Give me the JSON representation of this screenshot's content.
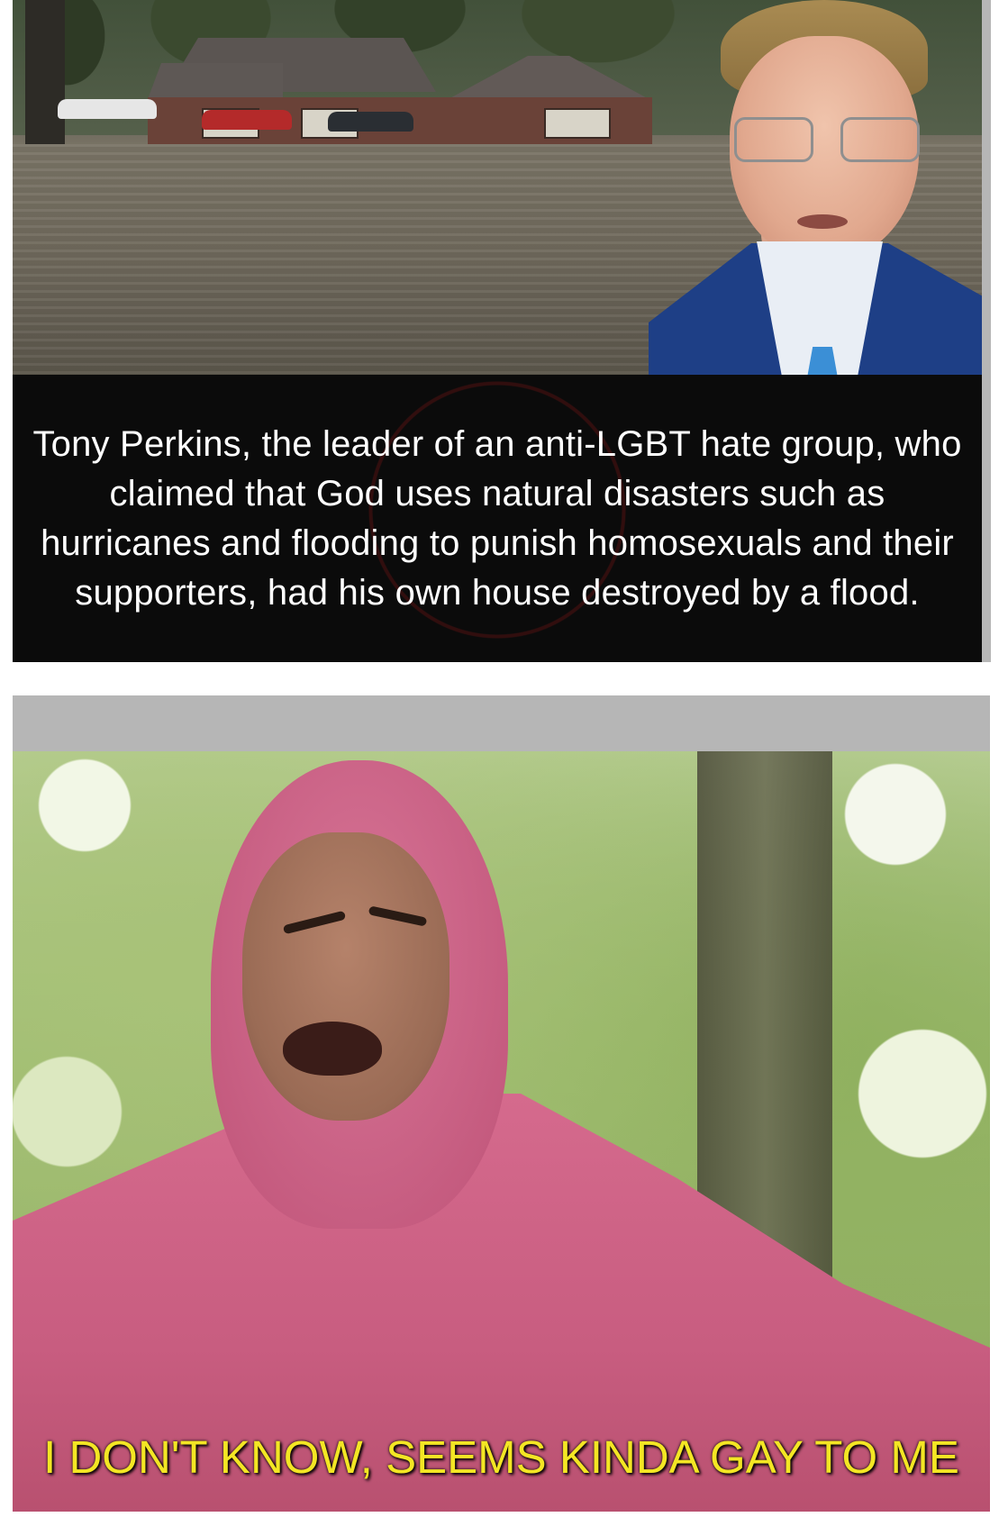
{
  "top_panel": {
    "caption": "Tony Perkins, the leader of an anti-LGBT hate group, who claimed that God uses natural disasters such as hurricanes and flooding to punish homosexuals and their supporters, had his own house destroyed by a flood."
  },
  "bottom_panel": {
    "caption": "I DON'T KNOW, SEEMS KINDA GAY TO ME"
  },
  "colors": {
    "caption_top_text": "#ffffff",
    "caption_bottom_text": "#f3e624",
    "panel_border": "#b6b6b6",
    "suit": "#1e3f86",
    "pink_suit": "#c85d80"
  }
}
